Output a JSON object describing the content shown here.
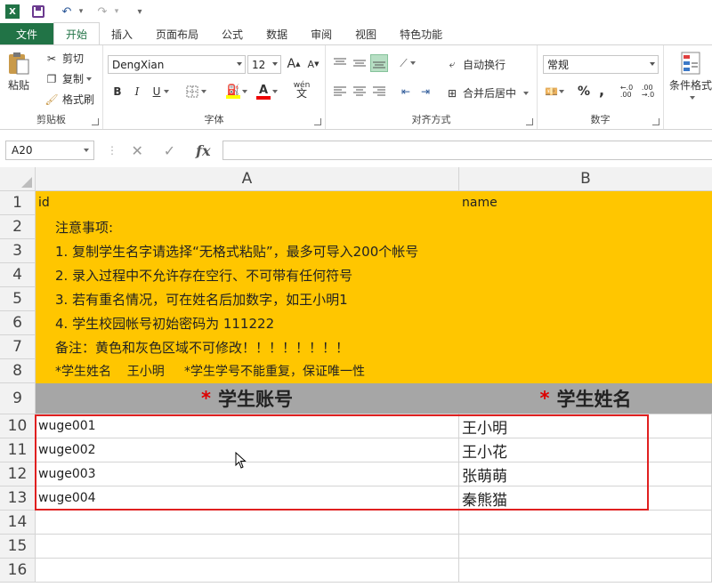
{
  "quick_access": {
    "logo": "X",
    "undo": "↶",
    "redo": "↷",
    "customize": "▾"
  },
  "tabs": [
    "文件",
    "开始",
    "插入",
    "页面布局",
    "公式",
    "数据",
    "审阅",
    "视图",
    "特色功能"
  ],
  "ribbon": {
    "clipboard": {
      "paste": "粘贴",
      "cut": "剪切",
      "copy": "复制",
      "format_painter": "格式刷",
      "label": "剪贴板"
    },
    "font": {
      "name": "DengXian",
      "size": "12",
      "label": "字体",
      "bold": "B",
      "italic": "I",
      "underline": "U",
      "grow": "A",
      "shrink": "A",
      "phonetic": "wén"
    },
    "alignment": {
      "wrap": "自动换行",
      "merge": "合并后居中",
      "label": "对齐方式"
    },
    "number": {
      "format": "常规",
      "label": "数字",
      "percent": "%",
      "comma": ","
    },
    "styles": {
      "conditional": "条件格式"
    }
  },
  "formula_bar": {
    "name_box": "A20",
    "fx": "fx",
    "formula": ""
  },
  "columns": [
    "A",
    "B"
  ],
  "rows": [
    "1",
    "2",
    "3",
    "4",
    "5",
    "6",
    "7",
    "8",
    "9",
    "10",
    "11",
    "12",
    "13",
    "14",
    "15",
    "16"
  ],
  "sheet": {
    "row1": {
      "a": "id",
      "b": "name"
    },
    "notes": [
      "注意事项:",
      "1. 复制学生名字请选择“无格式粘贴”，最多可导入200个帐号",
      "2. 录入过程中不允许存在空行、不可带有任何符号",
      "3. 若有重名情况，可在姓名后加数字，如王小明1",
      "4. 学生校园帐号初始密码为 111222",
      "备注：黄色和灰色区域不可修改！！！！！！！！",
      "*学生姓名    王小明     *学生学号不能重复，保证唯一性"
    ],
    "header": {
      "star": "*",
      "account": "学生账号",
      "name": "学生姓名"
    },
    "data_rows": [
      {
        "account": "wuge001",
        "name": "王小明"
      },
      {
        "account": "wuge002",
        "name": "王小花"
      },
      {
        "account": "wuge003",
        "name": "张萌萌"
      },
      {
        "account": "wuge004",
        "name": "秦熊猫"
      }
    ]
  },
  "colors": {
    "excel_green": "#217346",
    "note_yellow": "#ffc600",
    "header_grey": "#a6a6a6",
    "highlight_red": "#e02020"
  }
}
